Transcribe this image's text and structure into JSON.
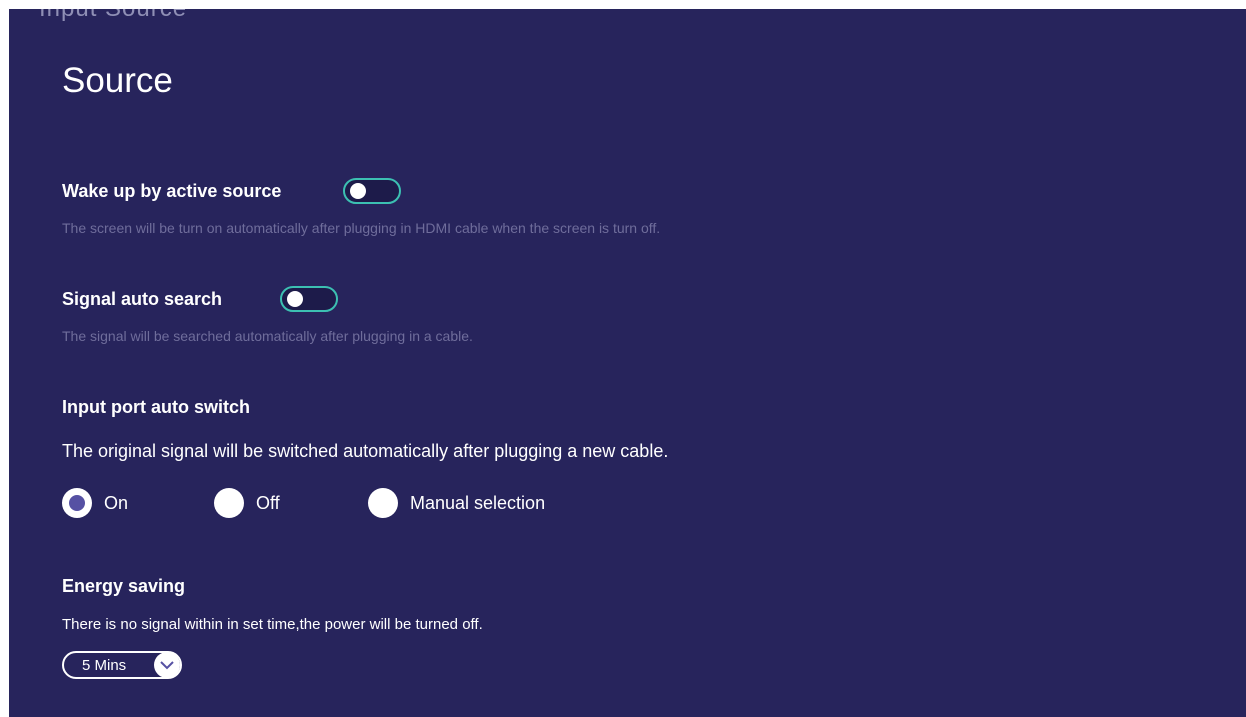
{
  "header": {
    "partial_title": "Input Source",
    "title": "Source"
  },
  "settings": {
    "wake_up": {
      "label": "Wake up by active source",
      "enabled": false,
      "description": "The screen will be turn on automatically after plugging in HDMI cable when the screen is turn off."
    },
    "signal_search": {
      "label": "Signal auto search",
      "enabled": false,
      "description": "The signal will be searched automatically after plugging in a cable."
    },
    "port_switch": {
      "label": "Input port auto switch",
      "description": "The original signal will be switched automatically after plugging a new cable.",
      "options": [
        "On",
        "Off",
        "Manual selection"
      ],
      "selected": "On"
    },
    "energy_saving": {
      "label": "Energy saving",
      "description": "There is no signal within in set time,the power will be turned off.",
      "selected_value": "5 Mins"
    }
  },
  "colors": {
    "background": "#27245c",
    "toggle_border": "#3cc0b2",
    "dim_text": "#6f6d9b",
    "radio_checked": "#5651a3"
  }
}
